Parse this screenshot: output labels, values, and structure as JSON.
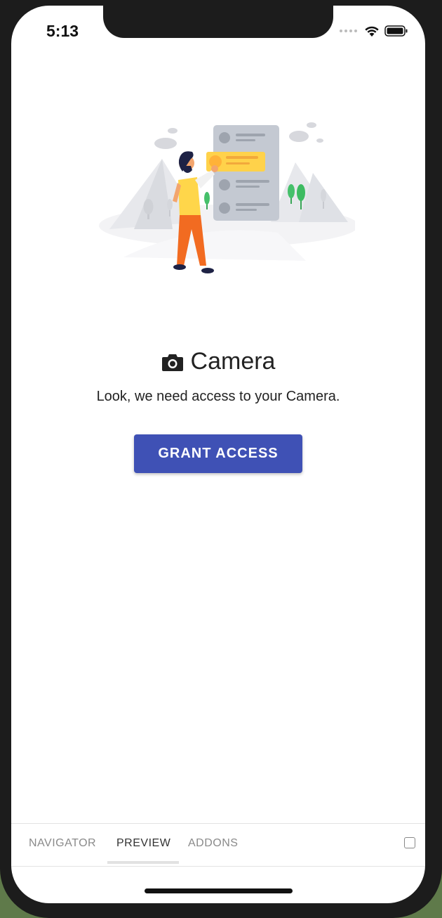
{
  "status_bar": {
    "time": "5:13"
  },
  "camera_prompt": {
    "title": "Camera",
    "message": "Look, we need access to your Camera.",
    "button_label": "GRANT ACCESS",
    "icon": "camera-icon",
    "accent_color": "#3f51b5"
  },
  "tabs": [
    {
      "label": "NAVIGATOR",
      "active": false
    },
    {
      "label": "PREVIEW",
      "active": true
    },
    {
      "label": "ADDONS",
      "active": false
    }
  ]
}
